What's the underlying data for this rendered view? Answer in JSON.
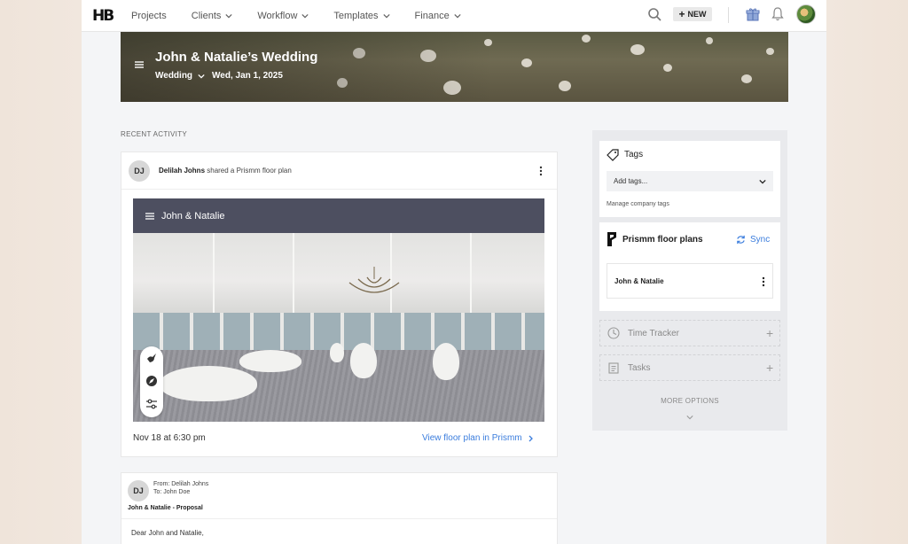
{
  "topnav": {
    "logo": "HB",
    "items": [
      {
        "label": "Projects",
        "has_dropdown": false
      },
      {
        "label": "Clients",
        "has_dropdown": true
      },
      {
        "label": "Workflow",
        "has_dropdown": true
      },
      {
        "label": "Templates",
        "has_dropdown": true
      },
      {
        "label": "Finance",
        "has_dropdown": true
      }
    ],
    "new_label": "NEW",
    "icons": [
      "search-icon",
      "plus-icon",
      "gift-icon",
      "bell-icon",
      "avatar"
    ]
  },
  "banner": {
    "title": "John & Natalie’s Wedding",
    "project_type": "Wedding",
    "date": "Wed, Jan 1, 2025"
  },
  "recent_activity": {
    "heading": "RECENT ACTIVITY",
    "card1": {
      "initials": "DJ",
      "actor": "Delilah Johns",
      "action": " shared a Prismm floor plan",
      "embed_title": "John & Natalie",
      "timestamp": "Nov 18 at 6:30 pm",
      "link_label": "View floor plan in Prismm"
    },
    "card2": {
      "initials": "DJ",
      "from_label": "From: ",
      "from_name": "Delilah Johns",
      "to_label": "To: ",
      "to_name": "John Doe",
      "title": "John & Natalie - Proposal",
      "greeting": "Dear John and Natalie,"
    }
  },
  "sidebar": {
    "tags": {
      "title": "Tags",
      "placeholder": "Add tags...",
      "manage_link": "Manage company tags"
    },
    "prismm": {
      "title": "Prismm floor plans",
      "sync_label": "Sync",
      "plan_name": "John & Natalie"
    },
    "time_tracker": "Time Tracker",
    "tasks": "Tasks",
    "more_options": "MORE OPTIONS"
  },
  "colors": {
    "link_blue": "#3b7ddd",
    "embed_header": "#4d4f60",
    "page_bg": "#f4f5f7",
    "outer_bg": "#f1e7de"
  }
}
